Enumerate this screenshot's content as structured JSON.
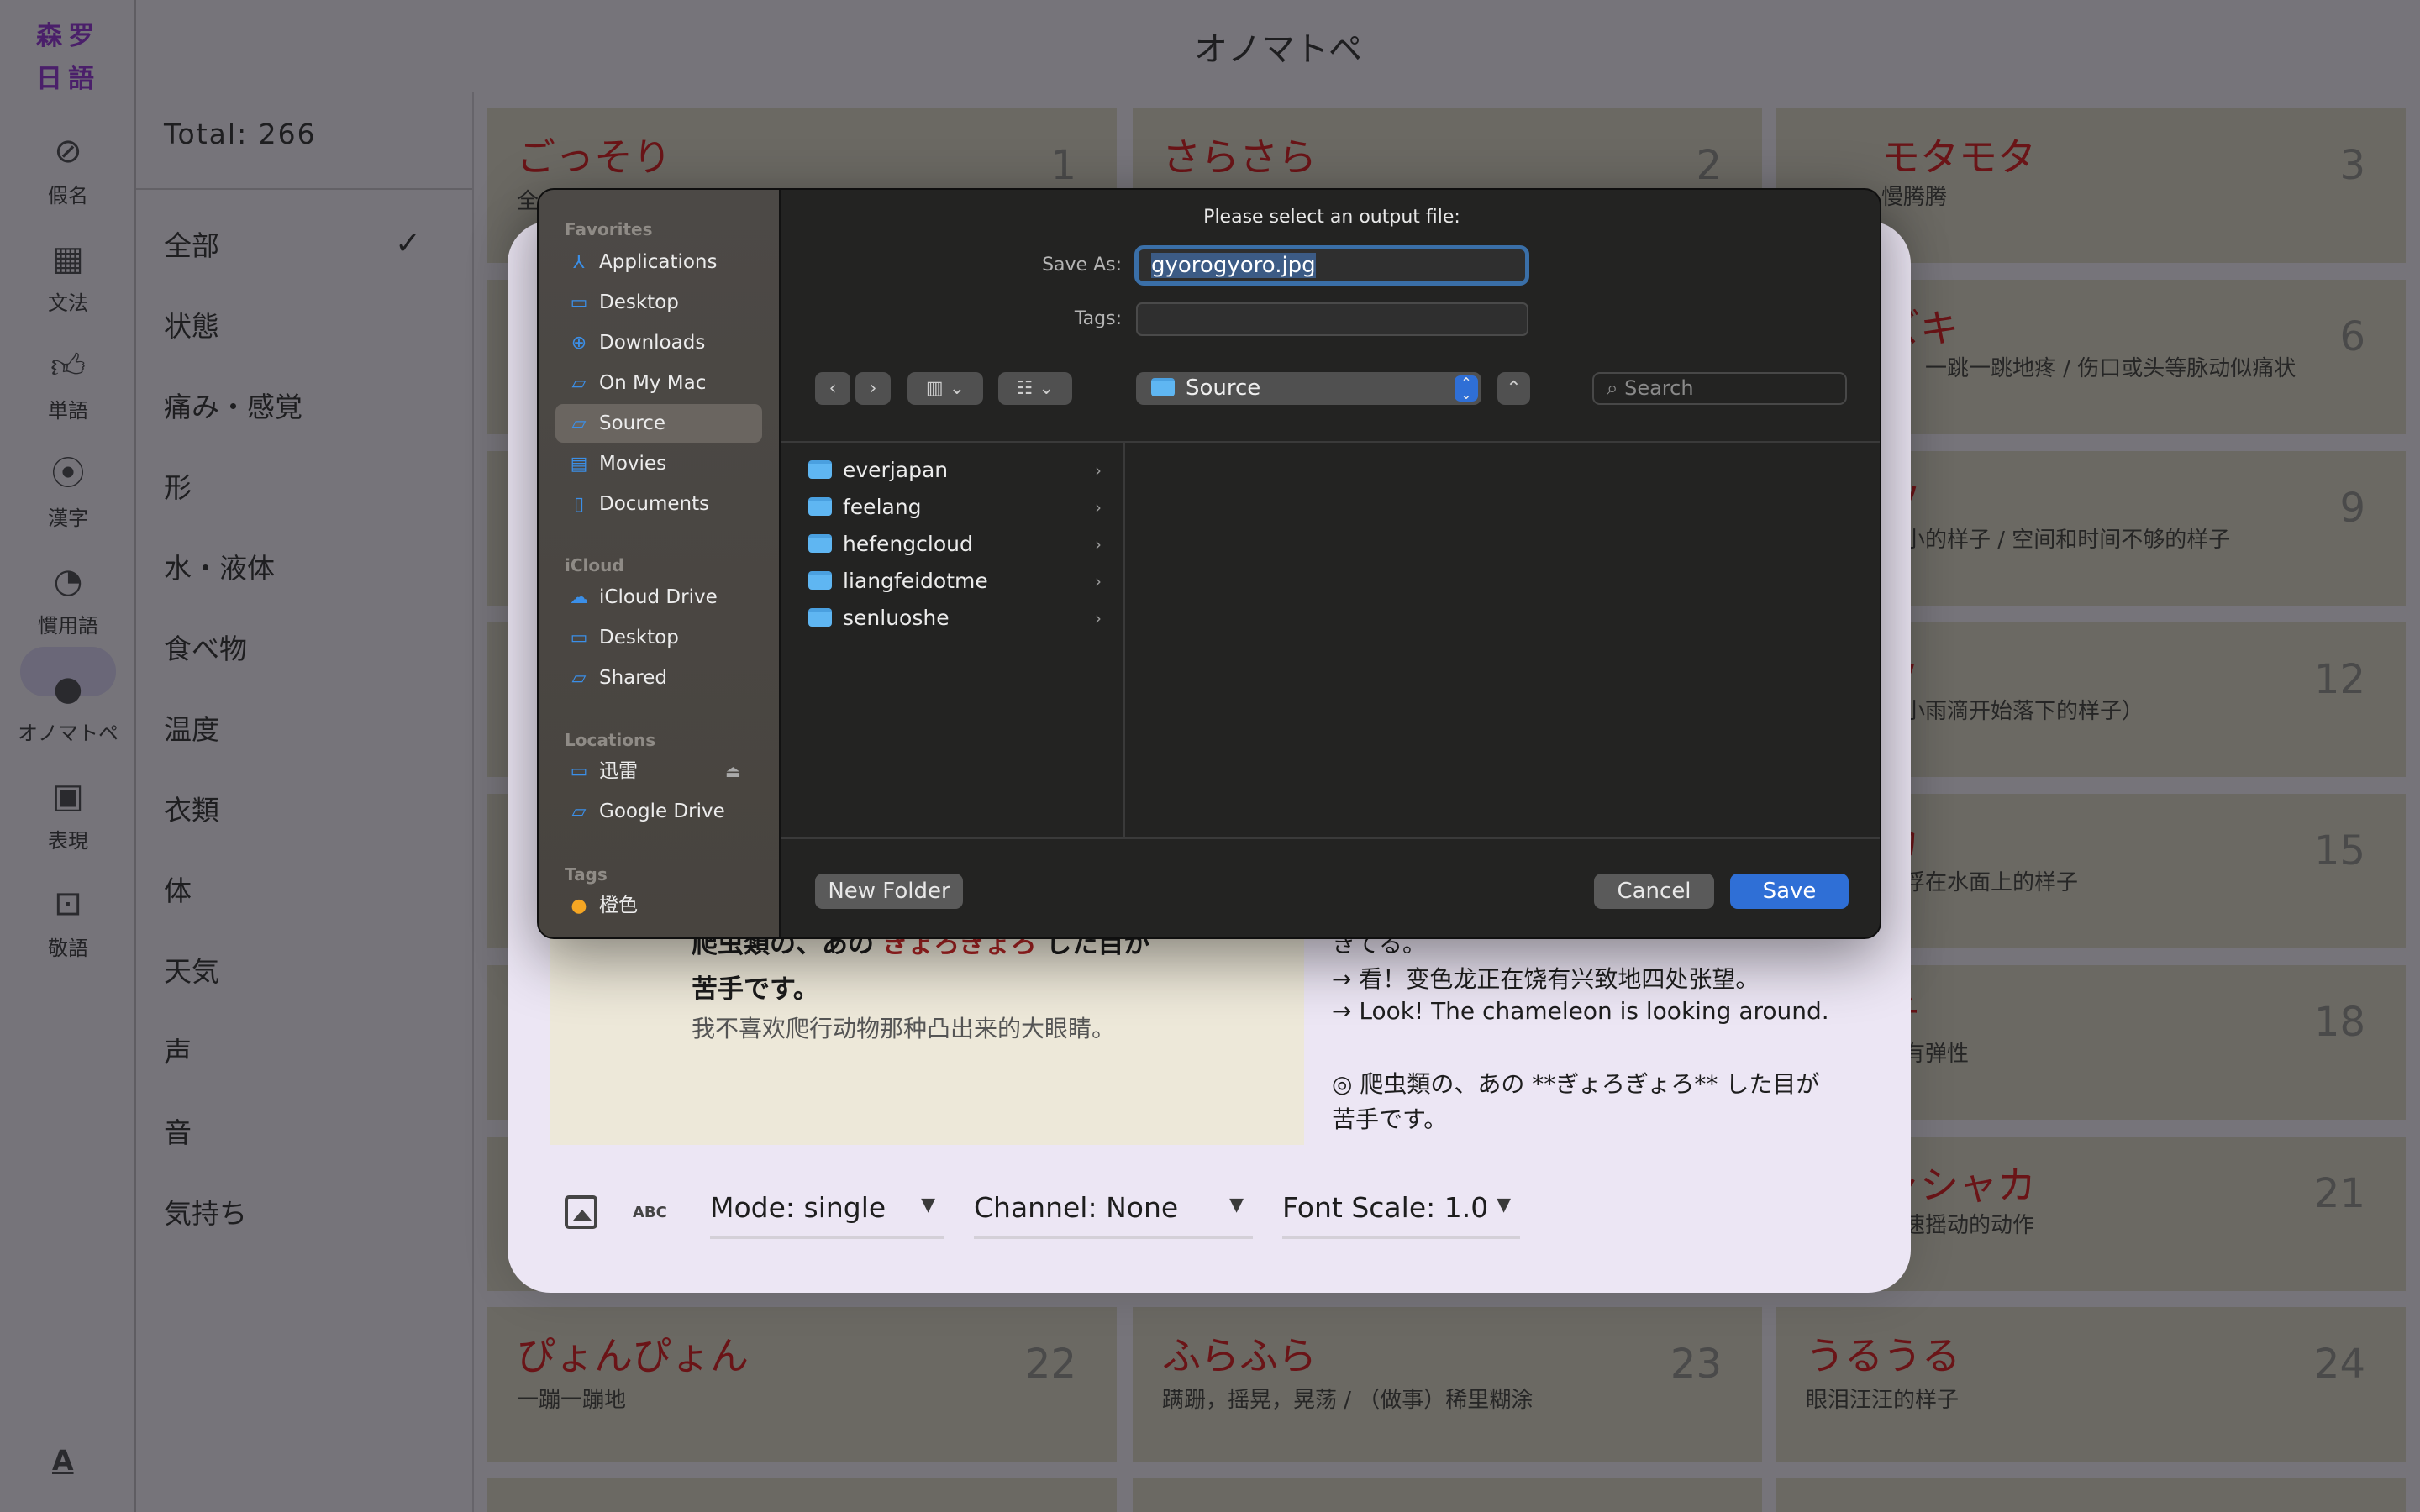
{
  "app": {
    "logo": "森罗日語",
    "page_title": "オノマトペ"
  },
  "rail": [
    {
      "label": "假名",
      "icon": "compass-icon"
    },
    {
      "label": "文法",
      "icon": "grid-icon"
    },
    {
      "label": "単語",
      "icon": "thumb-up-icon"
    },
    {
      "label": "漢字",
      "icon": "location-pin-icon"
    },
    {
      "label": "慣用語",
      "icon": "pie-icon"
    },
    {
      "label": "オノマトペ",
      "icon": "android-icon",
      "selected": true
    },
    {
      "label": "表現",
      "icon": "speaker-icon"
    },
    {
      "label": "敬語",
      "icon": "portrait-icon"
    }
  ],
  "rail_bottom_icon": "font-icon",
  "filter": {
    "total": "Total: 266",
    "items": [
      "全部",
      "状態",
      "痛み・感覚",
      "形",
      "水・液体",
      "食べ物",
      "温度",
      "衣類",
      "体",
      "天気",
      "声",
      "音",
      "気持ち"
    ],
    "selected": "全部"
  },
  "cards_top": [
    {
      "title": "ごっそり",
      "num": "1",
      "sub": "全"
    },
    {
      "title": "さらさら",
      "num": "2",
      "sub": ""
    },
    {
      "title": "モタモタ",
      "num": "3",
      "sub": "慢腾腾"
    }
  ],
  "cards_right": [
    {
      "title": "ズキ",
      "num": "6",
      "sub": "疼，一跳一跳地疼 / 伤口或头等脉动似痛状"
    },
    {
      "title": "ツ",
      "num": "9",
      "sub": "很小的样子 / 空间和时间不够的样子"
    },
    {
      "title": "ッ",
      "num": "12",
      "sub": "（小雨滴开始落下的样子）"
    },
    {
      "title": "カ",
      "num": "15",
      "sub": "漂浮在水面上的样子"
    },
    {
      "title": "チ",
      "num": "18",
      "sub": "软有弹性"
    },
    {
      "title": "ャシャカ",
      "num": "21",
      "sub": "快速摇动的动作"
    }
  ],
  "cards_bottom": [
    {
      "title": "ぴょんぴょん",
      "num": "22",
      "sub": "一蹦一蹦地"
    },
    {
      "title": "ふらふら",
      "num": "23",
      "sub": "蹒跚，摇晃，晃荡 / （做事）稀里糊涂"
    },
    {
      "title": "うるうる",
      "num": "24",
      "sub": "眼泪汪汪的样子"
    }
  ],
  "preview": {
    "jp_line1_pre": "爬虫類の、あの ",
    "jp_highlight": "ぎょろぎょろ",
    "jp_line1_post": " した目が",
    "jp_line2": "苦手です。",
    "zh": "我不喜欢爬行动物那种凸出来的大眼睛。",
    "right_top": "きてる。",
    "right_zh": "→ 看！变色龙正在饶有兴致地四处张望。",
    "right_en": "→ Look! The chameleon is looking around.",
    "right_md1": "◎ 爬虫類の、あの **ぎょろぎょろ** した目が",
    "right_md2": "苦手です。"
  },
  "toolbar": {
    "mode": "Mode: single",
    "channel": "Channel: None",
    "font_scale": "Font Scale: 1.0",
    "abc": "ABC"
  },
  "dialog": {
    "title": "Please select an output file:",
    "save_as_label": "Save As:",
    "save_as_value": "gyorogyoro.jpg",
    "tags_label": "Tags:",
    "tags_value": "",
    "location": "Source",
    "search_placeholder": "Search",
    "sidebar": {
      "favorites_header": "Favorites",
      "favorites": [
        {
          "label": "Applications",
          "icon": "applications-icon"
        },
        {
          "label": "Desktop",
          "icon": "desktop-icon"
        },
        {
          "label": "Downloads",
          "icon": "downloads-icon"
        },
        {
          "label": "On My Mac",
          "icon": "folder-icon"
        },
        {
          "label": "Source",
          "icon": "folder-icon",
          "selected": true
        },
        {
          "label": "Movies",
          "icon": "film-icon"
        },
        {
          "label": "Documents",
          "icon": "document-icon"
        }
      ],
      "icloud_header": "iCloud",
      "icloud": [
        {
          "label": "iCloud Drive",
          "icon": "cloud-icon"
        },
        {
          "label": "Desktop",
          "icon": "desktop-icon"
        },
        {
          "label": "Shared",
          "icon": "shared-folder-icon"
        }
      ],
      "locations_header": "Locations",
      "locations": [
        {
          "label": "迅雷",
          "icon": "drive-icon"
        },
        {
          "label": "Google Drive",
          "icon": "folder-icon"
        }
      ],
      "tags_header": "Tags",
      "tags": [
        {
          "label": "橙色",
          "color": "#f5a623"
        }
      ]
    },
    "files": [
      "everjapan",
      "feelang",
      "hefengcloud",
      "liangfeidotme",
      "senluoshe"
    ],
    "new_folder": "New Folder",
    "cancel": "Cancel",
    "save": "Save",
    "accent": "#2f6fd6"
  }
}
